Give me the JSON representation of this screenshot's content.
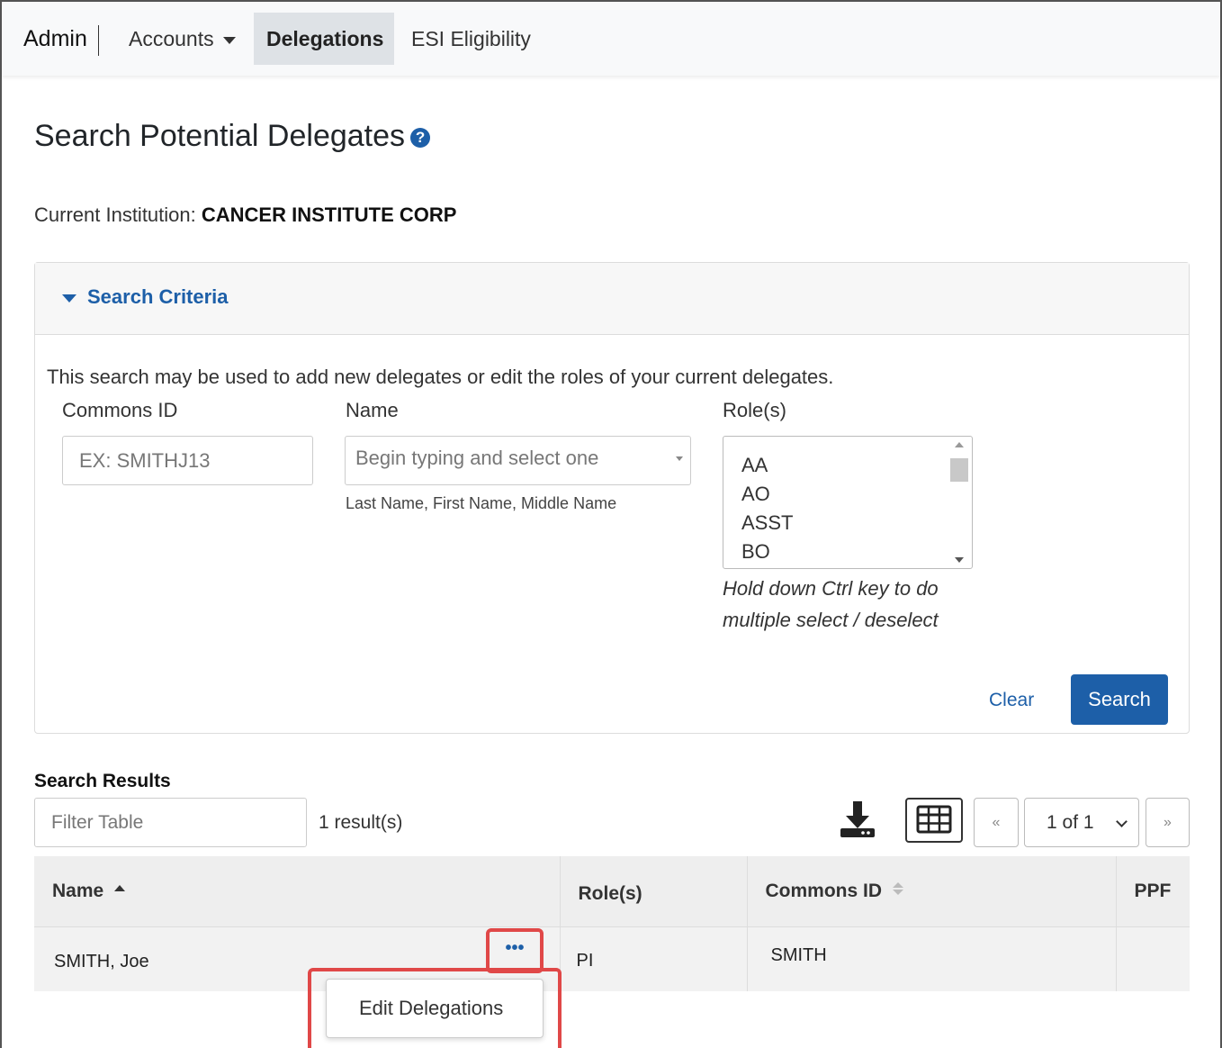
{
  "nav": {
    "brand": "Admin",
    "accounts": "Accounts",
    "delegations": "Delegations",
    "esi": "ESI Eligibility"
  },
  "page": {
    "title": "Search Potential Delegates",
    "help_icon": "question-circle-icon",
    "institution_label": "Current Institution:",
    "institution_name": "CANCER INSTITUTE CORP"
  },
  "criteria": {
    "header": "Search Criteria",
    "intro": "This search may be used to add new delegates or edit the roles of your current delegates.",
    "commons_id_label": "Commons ID",
    "commons_id_placeholder": "EX: SMITHJ13",
    "name_label": "Name",
    "name_placeholder": "Begin typing and select one",
    "name_hint": "Last Name, First Name, Middle Name",
    "roles_label": "Role(s)",
    "roles_options": [
      "AA",
      "AO",
      "ASST",
      "BO"
    ],
    "roles_hint": "Hold down Ctrl key to do multiple select / deselect",
    "clear": "Clear",
    "search": "Search"
  },
  "results": {
    "title": "Search Results",
    "filter_placeholder": "Filter Table",
    "count": "1 result(s)",
    "download_icon": "download-icon",
    "columns_icon": "table-columns-icon",
    "prev": "«",
    "page": "1 of 1",
    "next": "»",
    "columns": [
      "Name",
      "Role(s)",
      "Commons ID",
      "PPF"
    ],
    "rows": [
      {
        "name": "SMITH, Joe",
        "actions": "•••",
        "roles": "PI",
        "commons_id": "SMITH",
        "ppf": ""
      }
    ],
    "menu_item": "Edit Delegations"
  },
  "colors": {
    "accent": "#1d5fa8",
    "highlight": "#e04848"
  }
}
